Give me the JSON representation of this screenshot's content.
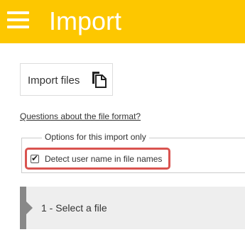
{
  "header": {
    "title": "Import",
    "menu_icon": "hamburger-menu-icon",
    "background_color": "#fdc700"
  },
  "import_button": {
    "label": "Import files",
    "icon": "files-copy-icon"
  },
  "help_link": {
    "text": "Questions about the file format?"
  },
  "options": {
    "legend": "Options for this import only",
    "checkbox_label": "Detect user name in file names",
    "checked": true,
    "highlight_color": "#d9534f"
  },
  "step": {
    "label": "1 - Select a file"
  }
}
